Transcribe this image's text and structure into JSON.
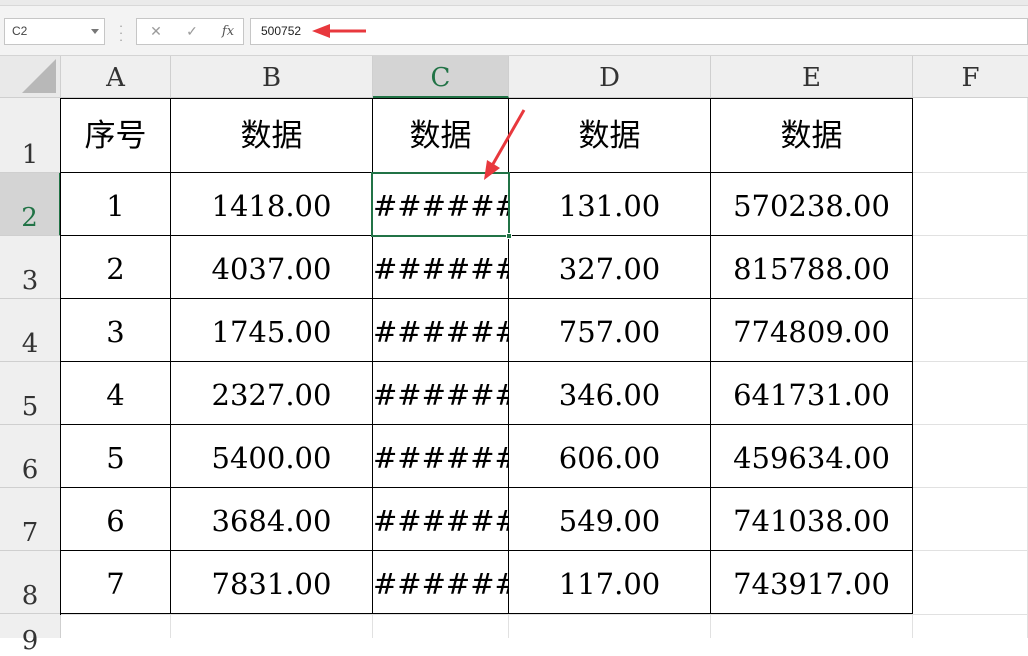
{
  "formula_bar": {
    "name_box": "C2",
    "cancel_glyph": "✕",
    "enter_glyph": "✓",
    "function_glyph": "fx",
    "formula_value": "500752"
  },
  "columns": [
    "A",
    "B",
    "C",
    "D",
    "E",
    "F"
  ],
  "rows": [
    "1",
    "2",
    "3",
    "4",
    "5",
    "6",
    "7",
    "8",
    "9"
  ],
  "header_row": [
    "序号",
    "数据",
    "数据",
    "数据",
    "数据"
  ],
  "data_rows": [
    [
      "1",
      "1418.00",
      "#######",
      "131.00",
      "570238.00"
    ],
    [
      "2",
      "4037.00",
      "#######",
      "327.00",
      "815788.00"
    ],
    [
      "3",
      "1745.00",
      "#######",
      "757.00",
      "774809.00"
    ],
    [
      "4",
      "2327.00",
      "#######",
      "346.00",
      "641731.00"
    ],
    [
      "5",
      "5400.00",
      "#######",
      "606.00",
      "459634.00"
    ],
    [
      "6",
      "3684.00",
      "#######",
      "549.00",
      "741038.00"
    ],
    [
      "7",
      "7831.00",
      "#######",
      "117.00",
      "743917.00"
    ]
  ],
  "selected_column": "C",
  "selected_row": "2",
  "colors": {
    "selection": "#217346",
    "annotation_arrow": "#e8383d"
  }
}
